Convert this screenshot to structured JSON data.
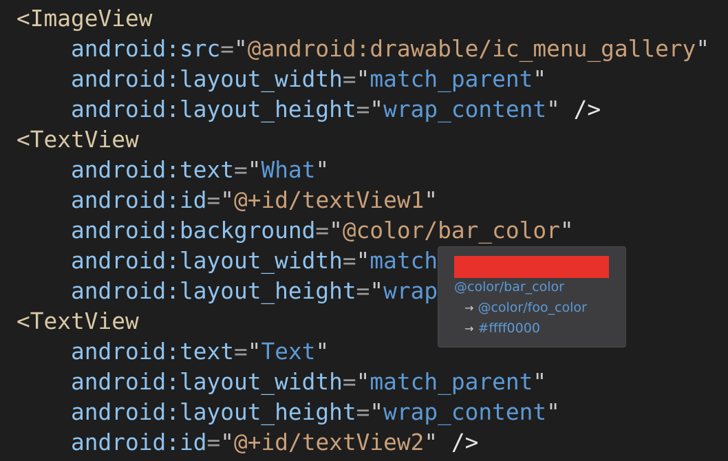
{
  "code_lines": [
    {
      "type": "tag",
      "tag": "<ImageView"
    },
    {
      "type": "attr",
      "name": "android:src",
      "value": "@android:drawable/ic_menu_gallery",
      "kind": "ref",
      "close": ""
    },
    {
      "type": "attr",
      "name": "android:layout_width",
      "value": "match_parent",
      "kind": "str",
      "close": ""
    },
    {
      "type": "attr",
      "name": "android:layout_height",
      "value": "wrap_content",
      "kind": "str",
      "close": " />"
    },
    {
      "type": "tag",
      "tag": "<TextView"
    },
    {
      "type": "attr",
      "name": "android:text",
      "value": "What",
      "kind": "str",
      "close": ""
    },
    {
      "type": "attr",
      "name": "android:id",
      "value": "@+id/textView1",
      "kind": "ref",
      "close": ""
    },
    {
      "type": "attr",
      "name": "android:background",
      "value": "@color/bar_color",
      "kind": "ref",
      "close": ""
    },
    {
      "type": "attr",
      "name": "android:layout_width",
      "value": "match_parent",
      "kind": "str",
      "close": ""
    },
    {
      "type": "attr",
      "name": "android:layout_height",
      "value": "wrap_content",
      "kind": "str",
      "close": ""
    },
    {
      "type": "tag",
      "tag": "<TextView"
    },
    {
      "type": "attr",
      "name": "android:text",
      "value": "Text",
      "kind": "str",
      "close": ""
    },
    {
      "type": "attr",
      "name": "android:layout_width",
      "value": "match_parent",
      "kind": "str",
      "close": ""
    },
    {
      "type": "attr",
      "name": "android:layout_height",
      "value": "wrap_content",
      "kind": "str",
      "close": ""
    },
    {
      "type": "attr",
      "name": "android:id",
      "value": "@+id/textView2",
      "kind": "ref",
      "close": " />"
    }
  ],
  "tooltip": {
    "swatch_color": "#e8312a",
    "resource": "@color/bar_color",
    "arrow": "→",
    "chain": [
      "@color/foo_color",
      "#ffff0000"
    ]
  }
}
